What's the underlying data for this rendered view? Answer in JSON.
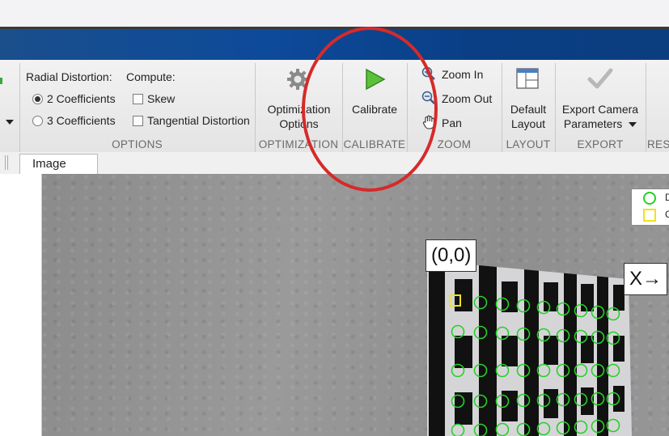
{
  "ribbon": {
    "options": {
      "radial_label": "Radial Distortion:",
      "radial_2": "2 Coefficients",
      "radial_3": "3 Coefficients",
      "compute_label": "Compute:",
      "skew": "Skew",
      "tangential": "Tangential Distortion",
      "section": "OPTIONS",
      "selected_radial": "2 Coefficients"
    },
    "optimization": {
      "button_line1": "Optimization",
      "button_line2": "Options",
      "section": "OPTIMIZATION"
    },
    "calibrate": {
      "button": "Calibrate",
      "section": "CALIBRATE"
    },
    "zoom": {
      "zoom_in": "Zoom In",
      "zoom_out": "Zoom Out",
      "pan": "Pan",
      "section": "ZOOM"
    },
    "layout": {
      "button_line1": "Default",
      "button_line2": "Layout",
      "section": "LAYOUT"
    },
    "export": {
      "button_line1": "Export Camera",
      "button_line2": "Parameters",
      "section": "EXPORT"
    },
    "res_partial": "RES"
  },
  "tabs": {
    "image": "Image"
  },
  "canvas": {
    "origin_label": "(0,0)",
    "x_axis_label": "X→",
    "legend_partial_1": "D",
    "legend_partial_2": "C"
  },
  "colors": {
    "title_blue": "#0d4a9a",
    "annotation_red": "#d62a2a",
    "detected_green": "#26d126",
    "origin_yellow": "#f2e11c"
  },
  "icons": [
    "gear-icon",
    "play-icon",
    "zoom-in-icon",
    "zoom-out-icon",
    "pan-hand-icon",
    "layout-grid-icon",
    "checkmark-icon"
  ]
}
